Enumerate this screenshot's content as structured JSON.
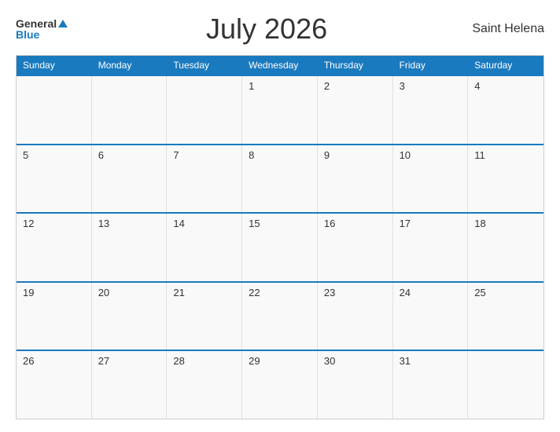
{
  "header": {
    "logo_general": "General",
    "logo_blue": "Blue",
    "title": "July 2026",
    "location": "Saint Helena"
  },
  "days_of_week": [
    "Sunday",
    "Monday",
    "Tuesday",
    "Wednesday",
    "Thursday",
    "Friday",
    "Saturday"
  ],
  "weeks": [
    [
      {
        "date": "",
        "empty": true
      },
      {
        "date": "",
        "empty": true
      },
      {
        "date": "",
        "empty": true
      },
      {
        "date": "1",
        "empty": false
      },
      {
        "date": "2",
        "empty": false
      },
      {
        "date": "3",
        "empty": false
      },
      {
        "date": "4",
        "empty": false
      }
    ],
    [
      {
        "date": "5",
        "empty": false
      },
      {
        "date": "6",
        "empty": false
      },
      {
        "date": "7",
        "empty": false
      },
      {
        "date": "8",
        "empty": false
      },
      {
        "date": "9",
        "empty": false
      },
      {
        "date": "10",
        "empty": false
      },
      {
        "date": "11",
        "empty": false
      }
    ],
    [
      {
        "date": "12",
        "empty": false
      },
      {
        "date": "13",
        "empty": false
      },
      {
        "date": "14",
        "empty": false
      },
      {
        "date": "15",
        "empty": false
      },
      {
        "date": "16",
        "empty": false
      },
      {
        "date": "17",
        "empty": false
      },
      {
        "date": "18",
        "empty": false
      }
    ],
    [
      {
        "date": "19",
        "empty": false
      },
      {
        "date": "20",
        "empty": false
      },
      {
        "date": "21",
        "empty": false
      },
      {
        "date": "22",
        "empty": false
      },
      {
        "date": "23",
        "empty": false
      },
      {
        "date": "24",
        "empty": false
      },
      {
        "date": "25",
        "empty": false
      }
    ],
    [
      {
        "date": "26",
        "empty": false
      },
      {
        "date": "27",
        "empty": false
      },
      {
        "date": "28",
        "empty": false
      },
      {
        "date": "29",
        "empty": false
      },
      {
        "date": "30",
        "empty": false
      },
      {
        "date": "31",
        "empty": false
      },
      {
        "date": "",
        "empty": true
      }
    ]
  ]
}
